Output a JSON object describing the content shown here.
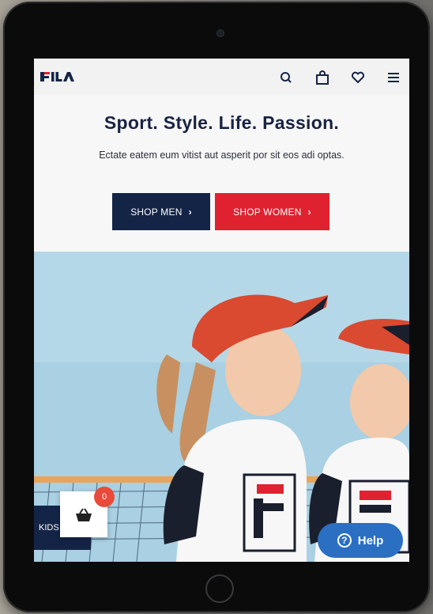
{
  "brand": {
    "logo_text": "FILA"
  },
  "header": {
    "icons": [
      "search-icon",
      "bag-icon",
      "heart-icon",
      "menu-icon"
    ]
  },
  "hero": {
    "headline": "Sport. Style. Life. Passion.",
    "subtext": "Ectate eatem eum vitist aut asperit por sit eos adi optas.",
    "shop_men_label": "SHOP MEN",
    "shop_women_label": "SHOP WOMEN",
    "chevron": "›"
  },
  "photo_overlay": {
    "kids_label": "KIDS"
  },
  "cart": {
    "count": "0"
  },
  "help": {
    "label": "Help",
    "icon_glyph": "?"
  },
  "colors": {
    "navy": "#142446",
    "red": "#e02230",
    "help_blue": "#2a6fc2",
    "badge": "#e94a3a"
  }
}
